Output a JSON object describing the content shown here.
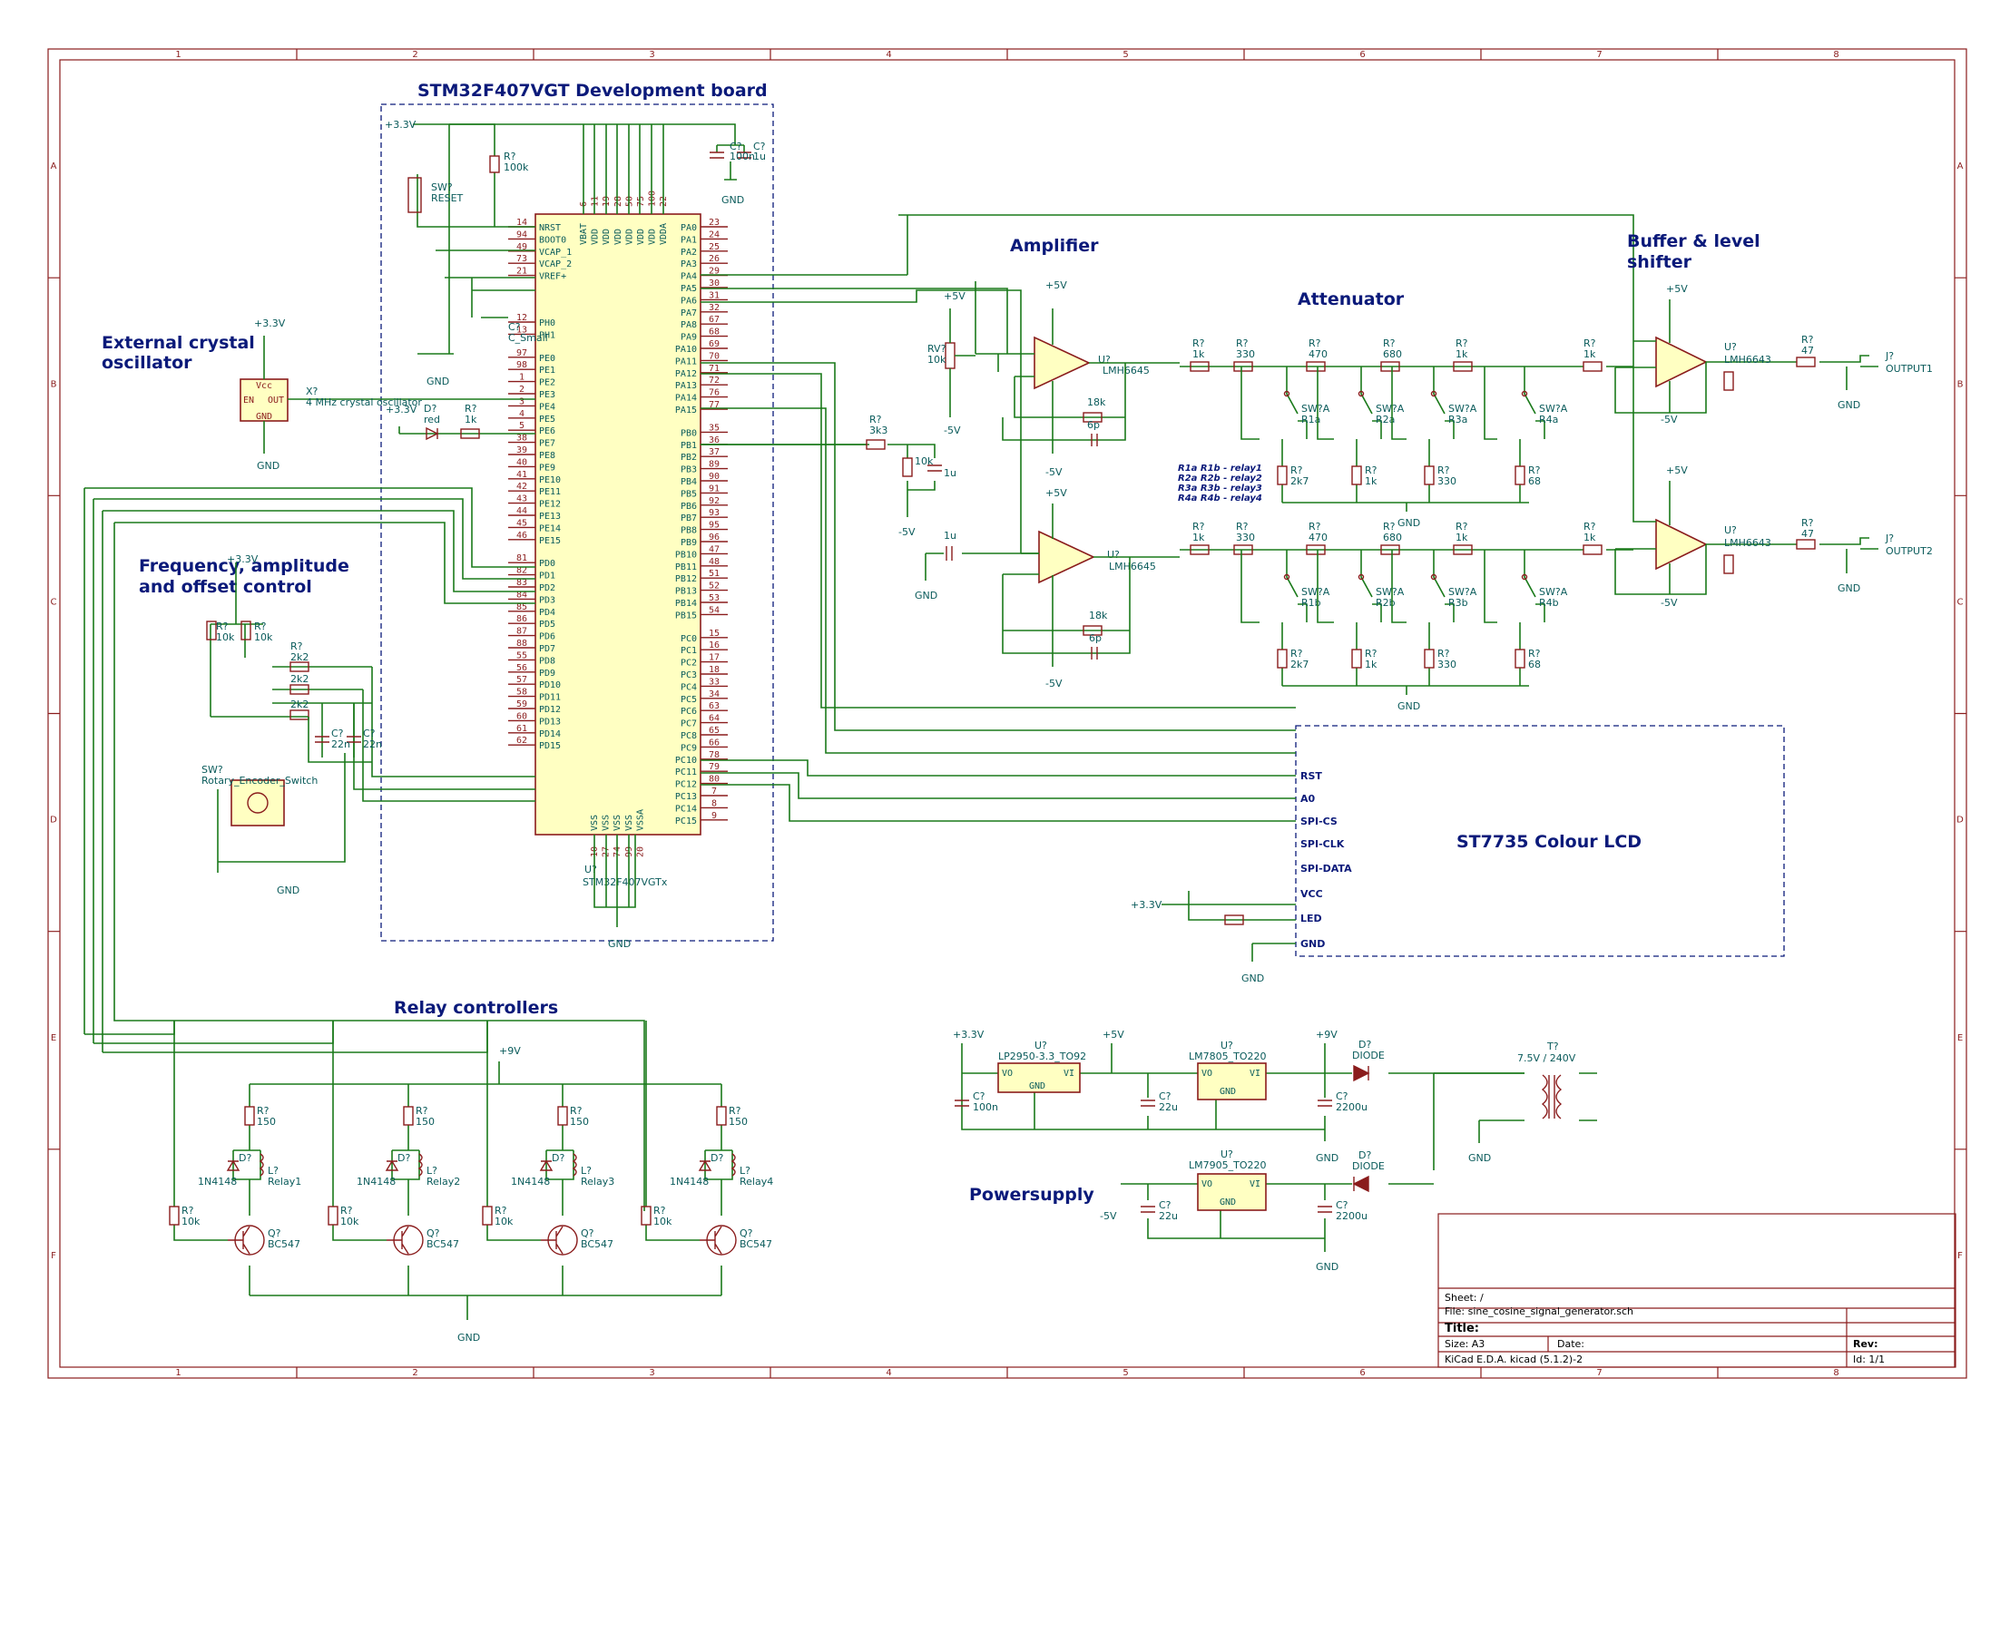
{
  "sheet": {
    "border_cols": [
      "1",
      "2",
      "3",
      "4",
      "5",
      "6",
      "7",
      "8"
    ],
    "border_rows": [
      "A",
      "B",
      "C",
      "D",
      "E",
      "F"
    ]
  },
  "sections": {
    "mcu_board": "STM32F407VGT Development board",
    "crystal": [
      "External crystal",
      "oscillator"
    ],
    "freq_control": [
      "Frequency, amplitude",
      "and offset control"
    ],
    "amplifier": "Amplifier",
    "attenuator": "Attenuator",
    "buffer": [
      "Buffer & level",
      "shifter"
    ],
    "relay_ctrl": "Relay controllers",
    "power": "Powersupply",
    "lcd": "ST7735 Colour LCD"
  },
  "mcu": {
    "ref": "U?",
    "value": "STM32F407VGTx",
    "left_pins": [
      {
        "num": "14",
        "name": "NRST"
      },
      {
        "num": "94",
        "name": "BOOT0"
      },
      {
        "num": "49",
        "name": "VCAP_1"
      },
      {
        "num": "73",
        "name": "VCAP_2"
      },
      {
        "num": "21",
        "name": "VREF+"
      },
      {
        "num": "12",
        "name": "PH0"
      },
      {
        "num": "13",
        "name": "PH1"
      },
      {
        "num": "97",
        "name": "PE0"
      },
      {
        "num": "98",
        "name": "PE1"
      },
      {
        "num": "1",
        "name": "PE2"
      },
      {
        "num": "2",
        "name": "PE3"
      },
      {
        "num": "3",
        "name": "PE4"
      },
      {
        "num": "4",
        "name": "PE5"
      },
      {
        "num": "5",
        "name": "PE6"
      },
      {
        "num": "38",
        "name": "PE7"
      },
      {
        "num": "39",
        "name": "PE8"
      },
      {
        "num": "40",
        "name": "PE9"
      },
      {
        "num": "41",
        "name": "PE10"
      },
      {
        "num": "42",
        "name": "PE11"
      },
      {
        "num": "43",
        "name": "PE12"
      },
      {
        "num": "44",
        "name": "PE13"
      },
      {
        "num": "45",
        "name": "PE14"
      },
      {
        "num": "46",
        "name": "PE15"
      },
      {
        "num": "81",
        "name": "PD0"
      },
      {
        "num": "82",
        "name": "PD1"
      },
      {
        "num": "83",
        "name": "PD2"
      },
      {
        "num": "84",
        "name": "PD3"
      },
      {
        "num": "85",
        "name": "PD4"
      },
      {
        "num": "86",
        "name": "PD5"
      },
      {
        "num": "87",
        "name": "PD6"
      },
      {
        "num": "88",
        "name": "PD7"
      },
      {
        "num": "55",
        "name": "PD8"
      },
      {
        "num": "56",
        "name": "PD9"
      },
      {
        "num": "57",
        "name": "PD10"
      },
      {
        "num": "58",
        "name": "PD11"
      },
      {
        "num": "59",
        "name": "PD12"
      },
      {
        "num": "60",
        "name": "PD13"
      },
      {
        "num": "61",
        "name": "PD14"
      },
      {
        "num": "62",
        "name": "PD15"
      }
    ],
    "right_pins": [
      {
        "num": "23",
        "name": "PA0"
      },
      {
        "num": "24",
        "name": "PA1"
      },
      {
        "num": "25",
        "name": "PA2"
      },
      {
        "num": "26",
        "name": "PA3"
      },
      {
        "num": "29",
        "name": "PA4"
      },
      {
        "num": "30",
        "name": "PA5"
      },
      {
        "num": "31",
        "name": "PA6"
      },
      {
        "num": "32",
        "name": "PA7"
      },
      {
        "num": "67",
        "name": "PA8"
      },
      {
        "num": "68",
        "name": "PA9"
      },
      {
        "num": "69",
        "name": "PA10"
      },
      {
        "num": "70",
        "name": "PA11"
      },
      {
        "num": "71",
        "name": "PA12"
      },
      {
        "num": "72",
        "name": "PA13"
      },
      {
        "num": "76",
        "name": "PA14"
      },
      {
        "num": "77",
        "name": "PA15"
      },
      {
        "num": "35",
        "name": "PB0"
      },
      {
        "num": "36",
        "name": "PB1"
      },
      {
        "num": "37",
        "name": "PB2"
      },
      {
        "num": "89",
        "name": "PB3"
      },
      {
        "num": "90",
        "name": "PB4"
      },
      {
        "num": "91",
        "name": "PB5"
      },
      {
        "num": "92",
        "name": "PB6"
      },
      {
        "num": "93",
        "name": "PB7"
      },
      {
        "num": "95",
        "name": "PB8"
      },
      {
        "num": "96",
        "name": "PB9"
      },
      {
        "num": "47",
        "name": "PB10"
      },
      {
        "num": "48",
        "name": "PB11"
      },
      {
        "num": "51",
        "name": "PB12"
      },
      {
        "num": "52",
        "name": "PB13"
      },
      {
        "num": "53",
        "name": "PB14"
      },
      {
        "num": "54",
        "name": "PB15"
      },
      {
        "num": "15",
        "name": "PC0"
      },
      {
        "num": "16",
        "name": "PC1"
      },
      {
        "num": "17",
        "name": "PC2"
      },
      {
        "num": "18",
        "name": "PC3"
      },
      {
        "num": "33",
        "name": "PC4"
      },
      {
        "num": "34",
        "name": "PC5"
      },
      {
        "num": "63",
        "name": "PC6"
      },
      {
        "num": "64",
        "name": "PC7"
      },
      {
        "num": "65",
        "name": "PC8"
      },
      {
        "num": "66",
        "name": "PC9"
      },
      {
        "num": "78",
        "name": "PC10"
      },
      {
        "num": "79",
        "name": "PC11"
      },
      {
        "num": "80",
        "name": "PC12"
      },
      {
        "num": "7",
        "name": "PC13"
      },
      {
        "num": "8",
        "name": "PC14"
      },
      {
        "num": "9",
        "name": "PC15"
      }
    ],
    "top_pins": [
      {
        "num": "6",
        "name": "VBAT"
      },
      {
        "num": "11",
        "name": "VDD"
      },
      {
        "num": "19",
        "name": "VDD"
      },
      {
        "num": "28",
        "name": "VDD"
      },
      {
        "num": "50",
        "name": "VDD"
      },
      {
        "num": "75",
        "name": "VDD"
      },
      {
        "num": "100",
        "name": "VDD"
      },
      {
        "num": "22",
        "name": "VDDA"
      }
    ],
    "bottom_pins": [
      {
        "num": "10",
        "name": "VSS"
      },
      {
        "num": "27",
        "name": "VSS"
      },
      {
        "num": "74",
        "name": "VSS"
      },
      {
        "num": "99",
        "name": "VSS"
      },
      {
        "num": "20",
        "name": "VSSA"
      }
    ]
  },
  "lcd_pins": [
    "RST",
    "A0",
    "SPI-CS",
    "SPI-CLK",
    "SPI-DATA",
    "VCC",
    "LED",
    "GND"
  ],
  "relay_map": [
    "R1a R1b - relay1",
    "R2a R2b - relay2",
    "R3a R3b - relay3",
    "R4a R4b - relay4"
  ],
  "title_block": {
    "sheet": "Sheet: /",
    "file": "File: sine_cosine_signal_generator.sch",
    "title": "Title:",
    "size": "Size: A3",
    "date": "Date:",
    "rev": "Rev:",
    "tool": "KiCad E.D.A.  kicad (5.1.2)-2",
    "id": "Id: 1/1"
  },
  "power": {
    "p33": "+3.3V",
    "p5": "+5V",
    "m5": "-5V",
    "p9": "+9V",
    "gnd": "GND"
  },
  "labels": {
    "sw_reset_ref": "SW?",
    "sw_reset_val": "RESET",
    "r100k_ref": "R?",
    "r100k_val": "100k",
    "c_top_ref": "C?",
    "c_top_val": "100n",
    "c_top2_ref": "C?",
    "c_top2_val": "1u",
    "c_vcap_ref": "C?",
    "c_vcap_val": "C_Small",
    "xtal_ref": "X?",
    "xtal_val": "4 MHz crystal oscillator",
    "xtal_pin_en": "EN",
    "xtal_pin_out": "OUT",
    "xtal_pin_vcc": "Vcc",
    "xtal_pin_gnd": "GND",
    "led_ref": "D?",
    "led_val": "red",
    "r1k_ref": "R?",
    "r1k_val": "1k",
    "enc_ref": "SW?",
    "enc_val": "Rotary_Encoder_Switch",
    "r10k_a_ref": "R?",
    "r10k_a_val": "10k",
    "r10k_b_ref": "R?",
    "r10k_b_val": "10k",
    "r2k2": "2k2",
    "r_ref": "R?",
    "c22n_ref": "C?",
    "c22n_val": "22n",
    "rv_ref": "RV?",
    "rv_val": "10k",
    "r3k3_val": "3k3",
    "r10k_val": "10k",
    "c1u_val": "1u",
    "amp_ref": "U?",
    "amp_val": "LMH6645",
    "r18k_val": "18k",
    "c6p_val": "6p",
    "buf_val": "LMH6643",
    "r47_val": "47",
    "j1_ref": "J?",
    "j1_val": "OUTPUT1",
    "j2_val": "OUTPUT2",
    "att_vals": [
      "1k",
      "330",
      "470",
      "680",
      "1k"
    ],
    "shunt_vals": [
      "2k7",
      "1k",
      "330",
      "68"
    ],
    "sw_refs_top": [
      "R1a",
      "R2a",
      "R3a",
      "R4a"
    ],
    "sw_refs_bot": [
      "R1b",
      "R2b",
      "R3b",
      "R4b"
    ],
    "sw_val": "SW?A",
    "relay_r_top": "150",
    "relay_r_base": "10k",
    "relay_diode": "1N4148",
    "relay_names": [
      "Relay1",
      "Relay2",
      "Relay3",
      "Relay4"
    ],
    "q_val": "BC547",
    "q_ref": "Q?",
    "l_ref": "L?",
    "ldo_val": "LP2950-3.3_TO92",
    "reg5_val": "LM7805_TO220",
    "regm5_val": "LM7905_TO220",
    "c100n": "100n",
    "c22u": "22u",
    "c2200u": "2200u",
    "diode_val": "DIODE",
    "trafo_ref": "T?",
    "trafo_val": "7.5V / 240V",
    "pin_vo": "VO",
    "pin_vi": "VI",
    "pin_gnd": "GND"
  },
  "colors": {
    "wire": "#1a7a1a",
    "component": "#8a1c1c",
    "ic_fill": "#ffffc2",
    "heading": "#0b1a7a",
    "value_text": "#0a5b5b"
  }
}
